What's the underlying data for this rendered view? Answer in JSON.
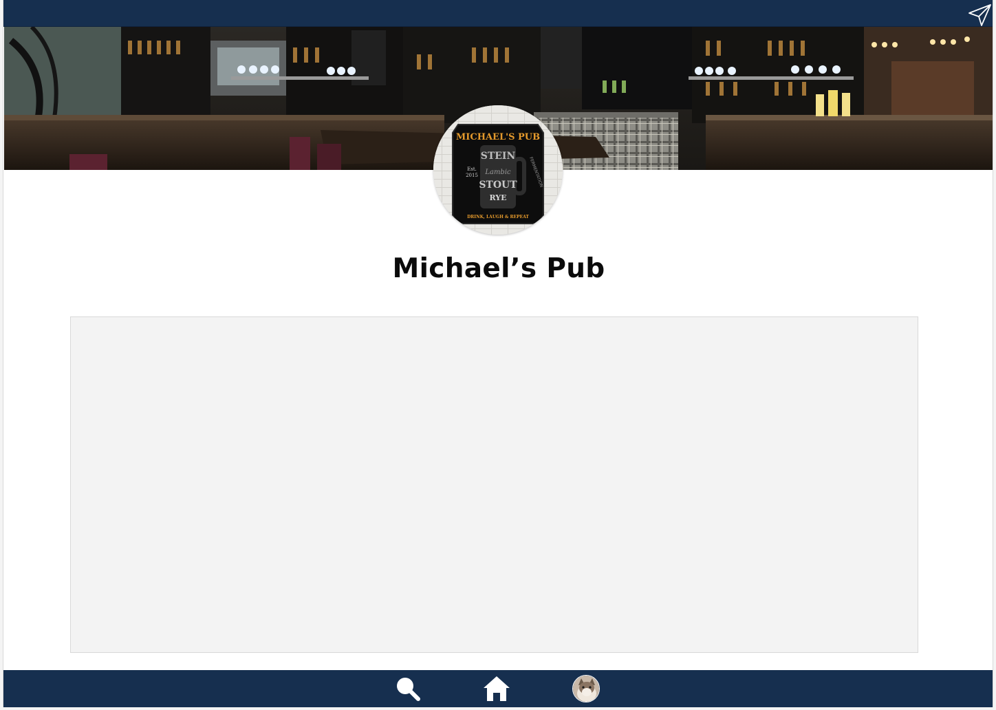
{
  "header": {
    "share_icon": "paper-plane-icon"
  },
  "banner": {
    "description_icon": "pub-interior-photo"
  },
  "logo": {
    "top_text": "MICHAEL'S PUB",
    "words": [
      "STEIN",
      "Lambic",
      "STOUT",
      "RYE"
    ],
    "est": "Est.",
    "est_year": "2015",
    "side_text": "FERMENTATION",
    "bottom_text": "DRINK, LAUGH & REPEAT"
  },
  "profile": {
    "title": "Michael’s Pub"
  },
  "bottom_nav": {
    "items": [
      {
        "icon": "search-icon"
      },
      {
        "icon": "home-icon"
      },
      {
        "icon": "avatar-icon"
      }
    ]
  },
  "colors": {
    "bar": "#162f4f",
    "panel": "#f3f3f3",
    "logo_accent": "#e59a2c"
  }
}
